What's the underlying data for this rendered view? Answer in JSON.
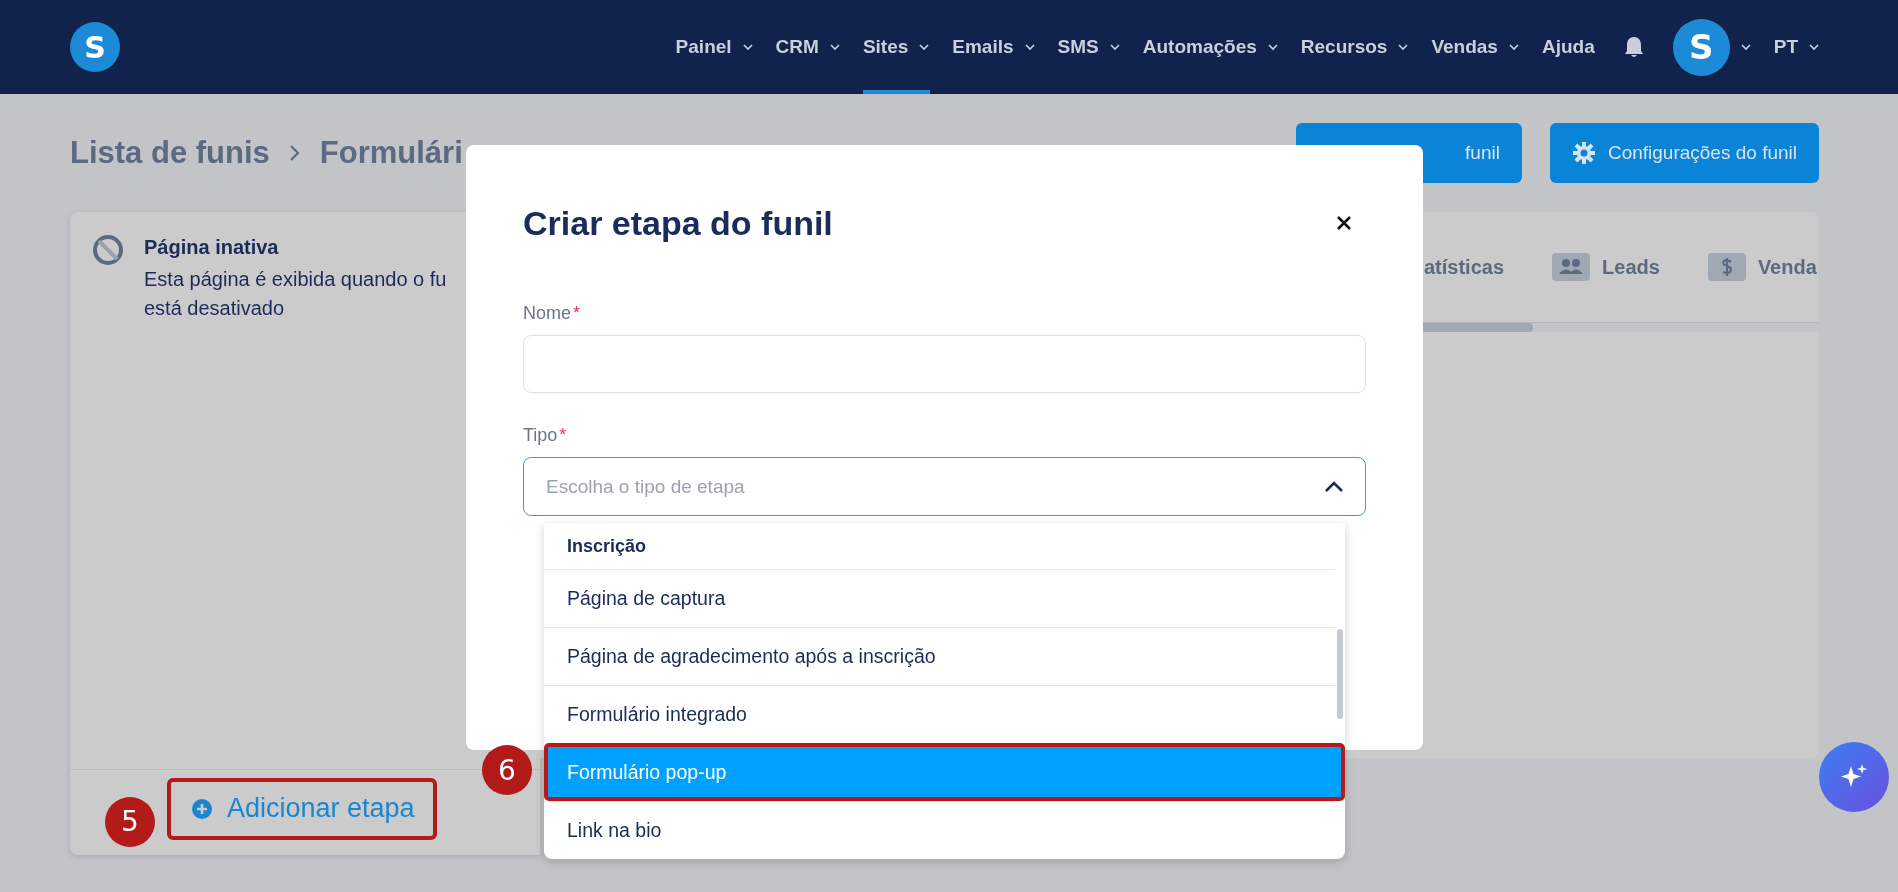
{
  "nav": {
    "logo": "S",
    "items": [
      {
        "label": "Painel",
        "dropdown": true,
        "selected": false
      },
      {
        "label": "CRM",
        "dropdown": true,
        "selected": false
      },
      {
        "label": "Sites",
        "dropdown": true,
        "selected": true
      },
      {
        "label": "Emails",
        "dropdown": true,
        "selected": false
      },
      {
        "label": "SMS",
        "dropdown": true,
        "selected": false
      },
      {
        "label": "Automações",
        "dropdown": true,
        "selected": false
      },
      {
        "label": "Recursos",
        "dropdown": true,
        "selected": false
      },
      {
        "label": "Vendas",
        "dropdown": true,
        "selected": false
      },
      {
        "label": "Ajuda",
        "dropdown": false,
        "selected": false
      }
    ],
    "avatar": "S",
    "language": "PT"
  },
  "breadcrumb": [
    "Lista de funis",
    "Formulári"
  ],
  "header_buttons": [
    {
      "label": "funil",
      "kind": "stats"
    },
    {
      "label": "Configurações do funil",
      "kind": "settings"
    }
  ],
  "inactive_page": {
    "title": "Página inativa",
    "description_lines": [
      "Esta página é exibida quando o fu",
      "está desativado"
    ]
  },
  "add_step": {
    "label": "Adicionar etapa",
    "callout": "5"
  },
  "stats_tabs": [
    {
      "label": "atísticas",
      "kind": "stats"
    },
    {
      "label": "Leads",
      "kind": "leads"
    },
    {
      "label": "Venda",
      "kind": "sales"
    }
  ],
  "modal": {
    "title": "Criar etapa do funil",
    "fields": [
      {
        "kind": "text",
        "label": "Nome",
        "required_mark": "*"
      },
      {
        "kind": "select",
        "label": "Tipo",
        "required_mark": "*",
        "placeholder": "Escolha o tipo de etapa",
        "expanded": true
      }
    ]
  },
  "dropdown": {
    "items": [
      {
        "kind": "header",
        "label": "Inscrição"
      },
      {
        "kind": "option",
        "label": "Página de captura",
        "selected": false
      },
      {
        "kind": "option",
        "label": "Página de agradecimento após a inscrição",
        "selected": false
      },
      {
        "kind": "option",
        "label": "Formulário integrado",
        "selected": false
      },
      {
        "kind": "option",
        "label": "Formulário pop-up",
        "selected": true,
        "callout": "6"
      },
      {
        "kind": "option",
        "label": "Link na bio",
        "selected": false
      }
    ]
  }
}
